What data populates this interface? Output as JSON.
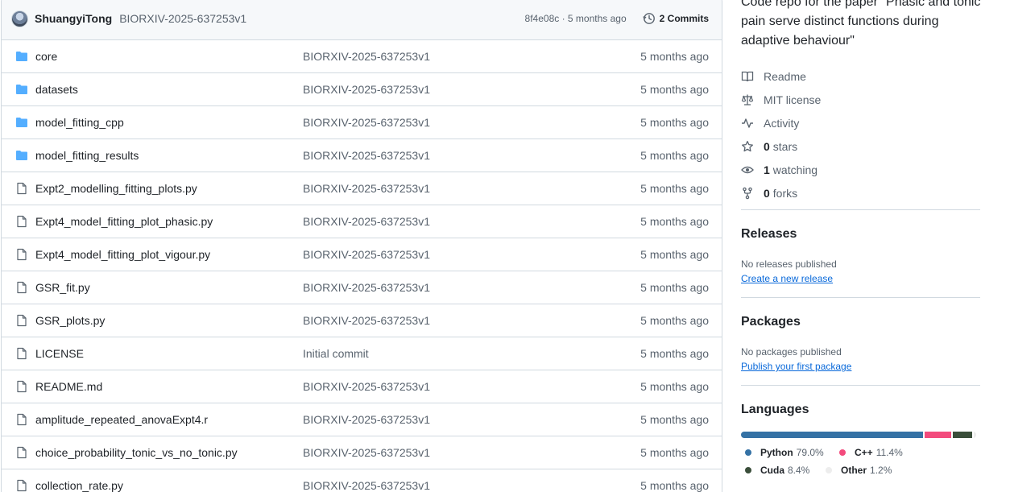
{
  "commit": {
    "author": "ShuangyiTong",
    "message": "BIORXIV-2025-637253v1",
    "hash_age": "8f4e08c · 5 months ago",
    "commits_label": "2 Commits"
  },
  "files": [
    {
      "name": "core",
      "type": "folder",
      "message": "BIORXIV-2025-637253v1",
      "age": "5 months ago"
    },
    {
      "name": "datasets",
      "type": "folder",
      "message": "BIORXIV-2025-637253v1",
      "age": "5 months ago"
    },
    {
      "name": "model_fitting_cpp",
      "type": "folder",
      "message": "BIORXIV-2025-637253v1",
      "age": "5 months ago"
    },
    {
      "name": "model_fitting_results",
      "type": "folder",
      "message": "BIORXIV-2025-637253v1",
      "age": "5 months ago"
    },
    {
      "name": "Expt2_modelling_fitting_plots.py",
      "type": "file",
      "message": "BIORXIV-2025-637253v1",
      "age": "5 months ago"
    },
    {
      "name": "Expt4_model_fitting_plot_phasic.py",
      "type": "file",
      "message": "BIORXIV-2025-637253v1",
      "age": "5 months ago"
    },
    {
      "name": "Expt4_model_fitting_plot_vigour.py",
      "type": "file",
      "message": "BIORXIV-2025-637253v1",
      "age": "5 months ago"
    },
    {
      "name": "GSR_fit.py",
      "type": "file",
      "message": "BIORXIV-2025-637253v1",
      "age": "5 months ago"
    },
    {
      "name": "GSR_plots.py",
      "type": "file",
      "message": "BIORXIV-2025-637253v1",
      "age": "5 months ago"
    },
    {
      "name": "LICENSE",
      "type": "file",
      "message": "Initial commit",
      "age": "5 months ago"
    },
    {
      "name": "README.md",
      "type": "file",
      "message": "BIORXIV-2025-637253v1",
      "age": "5 months ago"
    },
    {
      "name": "amplitude_repeated_anovaExpt4.r",
      "type": "file",
      "message": "BIORXIV-2025-637253v1",
      "age": "5 months ago"
    },
    {
      "name": "choice_probability_tonic_vs_no_tonic.py",
      "type": "file",
      "message": "BIORXIV-2025-637253v1",
      "age": "5 months ago"
    },
    {
      "name": "collection_rate.py",
      "type": "file",
      "message": "BIORXIV-2025-637253v1",
      "age": "5 months ago"
    }
  ],
  "about": {
    "description": "Code repo for the paper \"Phasic and tonic pain serve distinct functions during adaptive behaviour\"",
    "readme": "Readme",
    "license": "MIT license",
    "activity": "Activity",
    "stars_count": "0",
    "stars_label": "stars",
    "watching_count": "1",
    "watching_label": "watching",
    "forks_count": "0",
    "forks_label": "forks"
  },
  "releases": {
    "title": "Releases",
    "none": "No releases published",
    "link": "Create a new release"
  },
  "packages": {
    "title": "Packages",
    "none": "No packages published",
    "link": "Publish your first package"
  },
  "languages": {
    "title": "Languages",
    "items": [
      {
        "name": "Python",
        "percent": "79.0%",
        "value": 79.0,
        "color": "#3572A5"
      },
      {
        "name": "C++",
        "percent": "11.4%",
        "value": 11.4,
        "color": "#f34b7d"
      },
      {
        "name": "Cuda",
        "percent": "8.4%",
        "value": 8.4,
        "color": "#3A4E3A"
      },
      {
        "name": "Other",
        "percent": "1.2%",
        "value": 1.2,
        "color": "#ededed"
      }
    ]
  },
  "icons": {
    "folder": "folder-icon",
    "file": "file-icon",
    "history": "history-icon",
    "readme": "book-icon",
    "license": "law-icon",
    "activity": "pulse-icon",
    "stars": "star-icon",
    "watching": "eye-icon",
    "forks": "fork-icon"
  },
  "colors": {
    "folder": "#54aeff",
    "link": "#0969da",
    "muted": "#59636e",
    "border": "#d1d9e0"
  }
}
